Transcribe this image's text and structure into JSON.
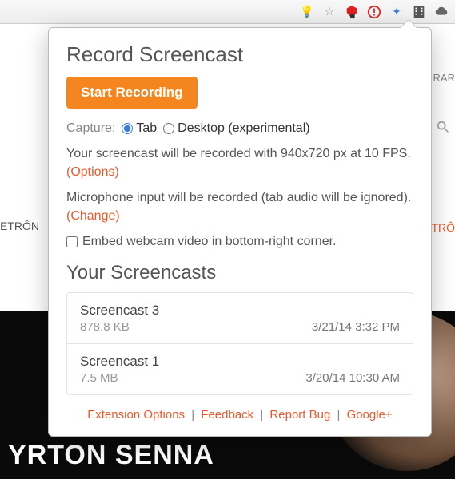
{
  "toolbar": {
    "icons": [
      "bulb-icon",
      "star-icon",
      "shield-icon",
      "alert-icon",
      "star2-icon",
      "film-icon",
      "cloud-icon"
    ]
  },
  "behind": {
    "left_frag": "ETRÔN",
    "right_frag": "RAR",
    "orange_frag": "TRÔ",
    "title_overlay": "YRTON SENNA"
  },
  "popup": {
    "title": "Record Screencast",
    "start_label": "Start Recording",
    "capture_label": "Capture:",
    "option_tab": "Tab",
    "option_desktop": "Desktop (experimental)",
    "info_line": "Your screencast will be recorded with 940x720 px at 10 FPS. ",
    "info_options": "(Options)",
    "mic_line": "Microphone input will be recorded (tab audio will be ignored). ",
    "mic_change": "(Change)",
    "embed_label": "Embed webcam video in bottom-right corner.",
    "list_title": "Your Screencasts",
    "items": [
      {
        "title": "Screencast 3",
        "size": "878.8 KB",
        "date": "3/21/14 3:32 PM"
      },
      {
        "title": "Screencast 1",
        "size": "7.5 MB",
        "date": "3/20/14 10:30 AM"
      }
    ],
    "footer": {
      "ext": "Extension Options",
      "feedback": "Feedback",
      "bug": "Report Bug",
      "gplus": "Google+"
    }
  }
}
